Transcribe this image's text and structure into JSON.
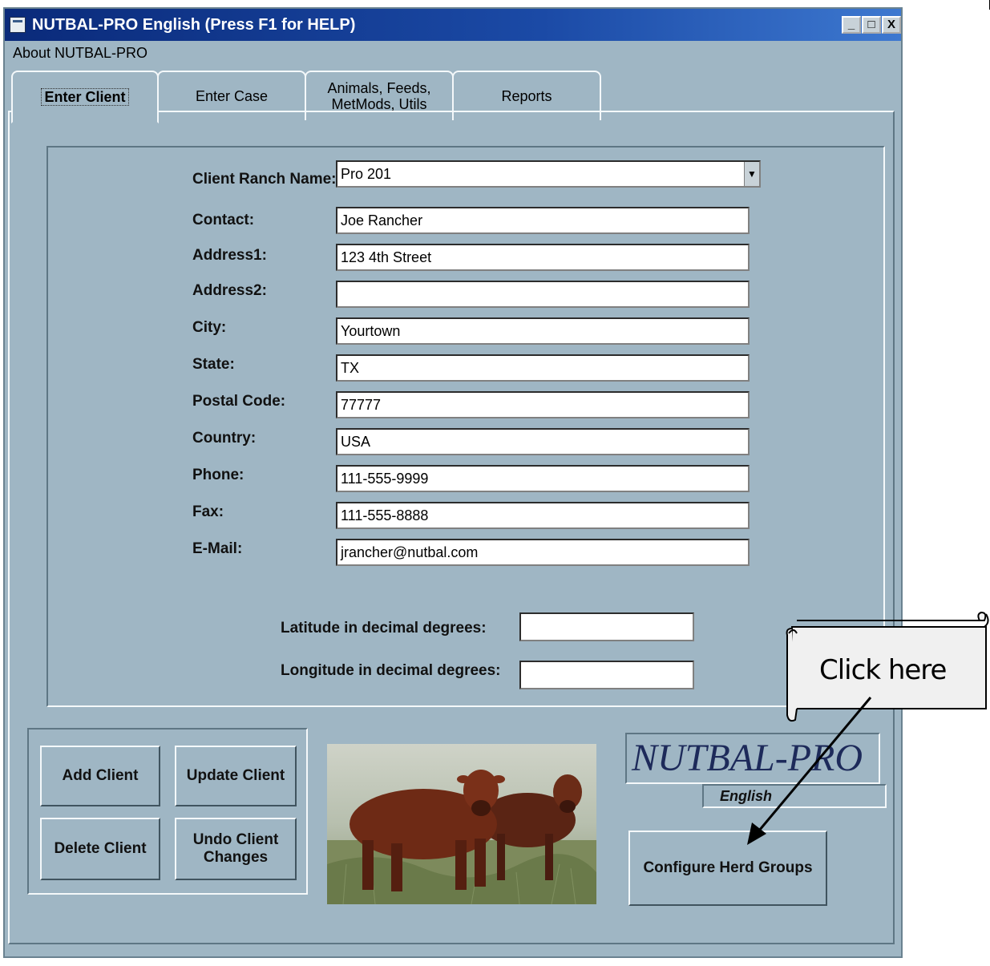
{
  "window": {
    "title": "NUTBAL-PRO English  (Press F1 for HELP)",
    "controls": [
      "_",
      "□",
      "X"
    ]
  },
  "menu": {
    "about": "About NUTBAL-PRO"
  },
  "tabs": [
    {
      "label": "Enter Client"
    },
    {
      "label": "Enter Case"
    },
    {
      "label": "Animals, Feeds,\nMetMods, Utils"
    },
    {
      "label": "Reports"
    }
  ],
  "form": {
    "ranch_name_label": "Client Ranch Name:",
    "ranch_name_value": "Pro 201",
    "fields": [
      {
        "label": "Contact:",
        "value": "Joe Rancher"
      },
      {
        "label": "Address1:",
        "value": "123 4th Street"
      },
      {
        "label": "Address2:",
        "value": ""
      },
      {
        "label": "City:",
        "value": "Yourtown"
      },
      {
        "label": "State:",
        "value": "TX"
      },
      {
        "label": "Postal Code:",
        "value": "77777"
      },
      {
        "label": "Country:",
        "value": "USA"
      },
      {
        "label": "Phone:",
        "value": "111-555-9999"
      },
      {
        "label": "Fax:",
        "value": "111-555-8888"
      },
      {
        "label": "E-Mail:",
        "value": "jrancher@nutbal.com"
      }
    ],
    "latitude_label": "Latitude in decimal degrees:",
    "latitude_value": "",
    "longitude_label": "Longitude in decimal degrees:",
    "longitude_value": ""
  },
  "buttons": {
    "add": "Add Client",
    "update": "Update Client",
    "delete": "Delete Client",
    "undo": "Undo Client\nChanges",
    "configure": "Configure Herd Groups"
  },
  "logo": {
    "title": "NUTBAL-PRO",
    "subtitle": "English"
  },
  "callout": {
    "text": "Click here"
  },
  "colors": {
    "window_bg": "#9fb6c4",
    "titlebar": "#0a2a7a"
  }
}
